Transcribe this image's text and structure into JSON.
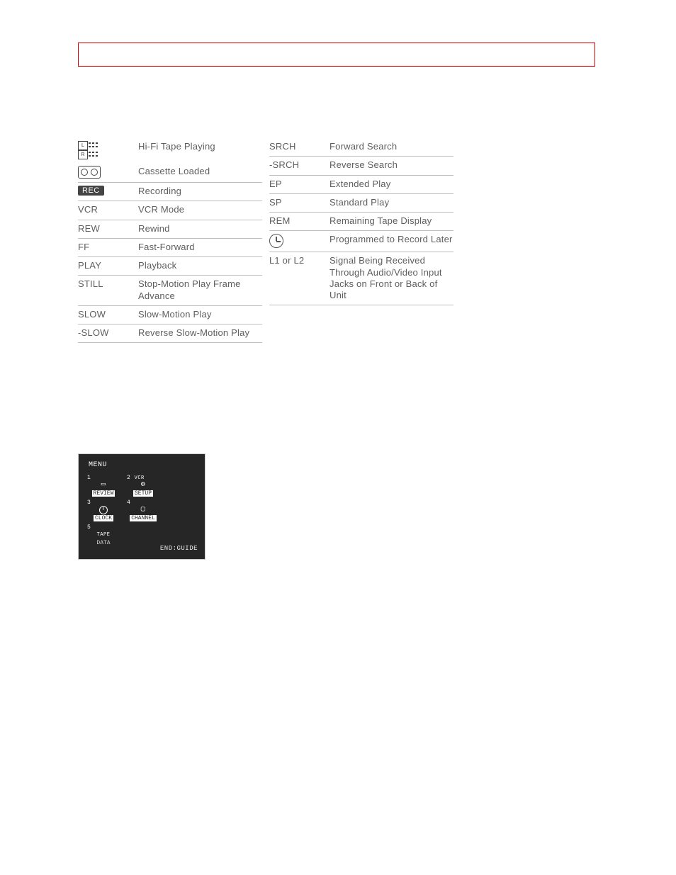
{
  "legend_left": [
    {
      "symbol_type": "hifi-icon",
      "symbol_text": "",
      "description": "Hi-Fi Tape Playing"
    },
    {
      "symbol_type": "cassette-icon",
      "symbol_text": "",
      "description": "Cassette Loaded"
    },
    {
      "symbol_type": "rec-pill",
      "symbol_text": "REC",
      "description": "Recording"
    },
    {
      "symbol_type": "text",
      "symbol_text": "VCR",
      "description": "VCR Mode"
    },
    {
      "symbol_type": "text",
      "symbol_text": "REW",
      "description": "Rewind"
    },
    {
      "symbol_type": "text",
      "symbol_text": "FF",
      "description": "Fast-Forward"
    },
    {
      "symbol_type": "text",
      "symbol_text": "PLAY",
      "description": "Playback"
    },
    {
      "symbol_type": "text",
      "symbol_text": "STILL",
      "description": "Stop-Motion Play Frame Advance"
    },
    {
      "symbol_type": "text",
      "symbol_text": "SLOW",
      "description": "Slow-Motion Play"
    },
    {
      "symbol_type": "text",
      "symbol_text": "-SLOW",
      "description": "Reverse Slow-Motion Play"
    }
  ],
  "legend_right": [
    {
      "symbol_type": "text",
      "symbol_text": "SRCH",
      "description": "Forward Search"
    },
    {
      "symbol_type": "text",
      "symbol_text": "-SRCH",
      "description": "Reverse Search"
    },
    {
      "symbol_type": "text",
      "symbol_text": "EP",
      "description": "Extended Play"
    },
    {
      "symbol_type": "text",
      "symbol_text": "SP",
      "description": "Standard Play"
    },
    {
      "symbol_type": "text",
      "symbol_text": "REM",
      "description": "Remaining Tape Display"
    },
    {
      "symbol_type": "clock-icon",
      "symbol_text": "",
      "description": "Programmed to Record Later"
    },
    {
      "symbol_type": "text",
      "symbol_text": "L1 or L2",
      "description": "Signal Being Received Through Audio/Video Input Jacks on Front or Back of Unit"
    }
  ],
  "tv_menu": {
    "title": "MENU",
    "items": [
      {
        "num": "1",
        "label": "REVIEW",
        "sub": "",
        "glyph": "page-icon"
      },
      {
        "num": "2",
        "label": "SETUP",
        "sub": "VCR",
        "glyph": "tools-icon"
      },
      {
        "num": "3",
        "label": "CLOCK",
        "sub": "",
        "glyph": "clock-icon"
      },
      {
        "num": "4",
        "label": "CHANNEL",
        "sub": "",
        "glyph": "tv-icon"
      },
      {
        "num": "5",
        "label": "DATA",
        "sub": "TAPE",
        "glyph": ""
      }
    ],
    "footer": "END:GUIDE"
  }
}
